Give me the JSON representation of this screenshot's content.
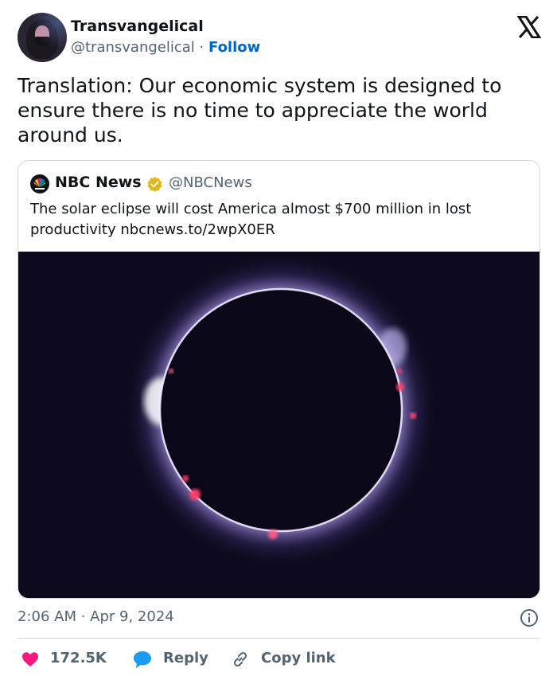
{
  "author": {
    "display_name": "Transvangelical",
    "handle": "@transvangelical",
    "separator": "·",
    "follow_label": "Follow"
  },
  "tweet": {
    "text": "Translation: Our economic system is designed to ensure there is no time to appreciate the world around us."
  },
  "quoted_tweet": {
    "display_name": "NBC News",
    "handle": "@NBCNews",
    "text": "The solar eclipse will cost America almost $700 million in lost productivity nbcnews.to/2wpX0ER"
  },
  "meta": {
    "timestamp": "2:06 AM · Apr 9, 2024"
  },
  "actions": {
    "like_count": "172.5K",
    "reply_label": "Reply",
    "copy_link_label": "Copy link"
  },
  "colors": {
    "link_blue": "#0066c5",
    "like_red": "#f91880",
    "reply_blue": "#1d9bf0",
    "secondary_text": "#536471",
    "verified_gold": "#e2b719"
  },
  "icons": [
    "x-logo-icon",
    "verified-badge-icon",
    "info-icon",
    "heart-icon",
    "reply-bubble-icon",
    "link-icon",
    "nbc-peacock-icon"
  ]
}
